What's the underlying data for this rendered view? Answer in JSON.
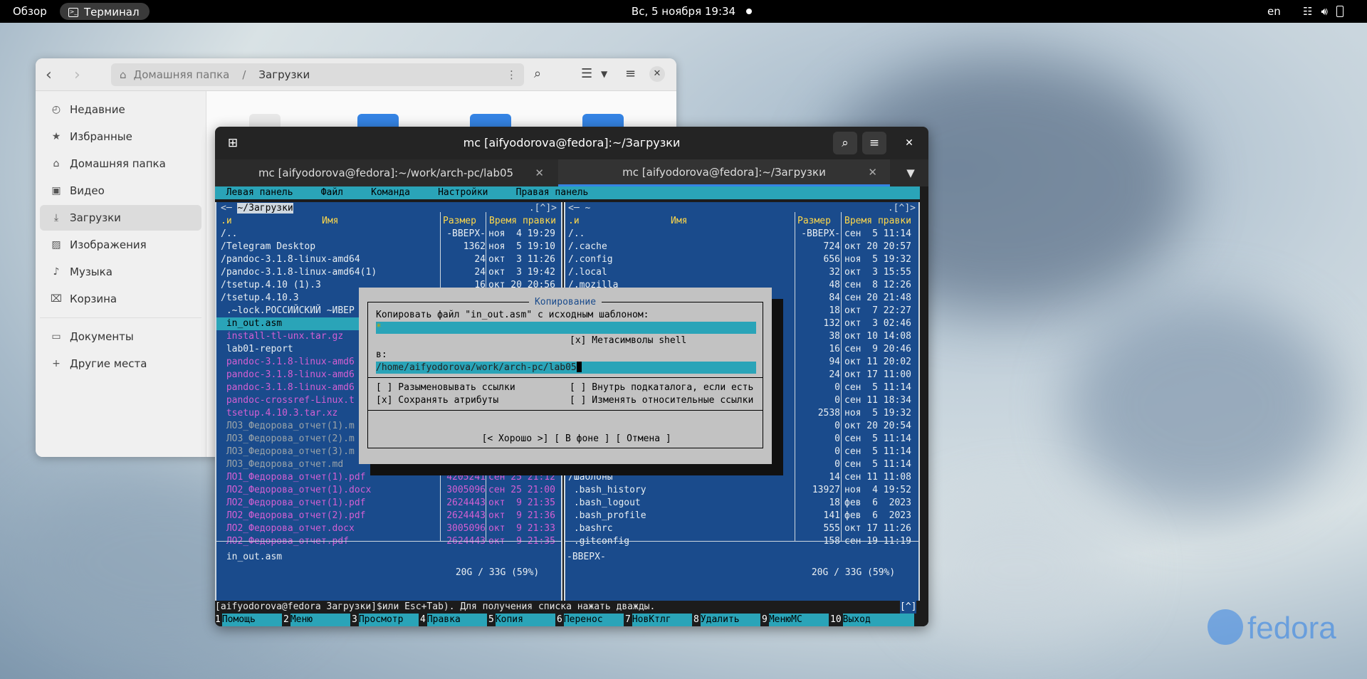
{
  "topbar": {
    "activities": "Обзор",
    "app": "Терминал",
    "clock": "Вс, 5 ноября  19:34",
    "lang": "en"
  },
  "files": {
    "path_home": "Домашняя папка",
    "path_sep": "/",
    "path_current": "Загрузки",
    "sidebar": [
      {
        "label": "Недавние",
        "icon": "clock-icon"
      },
      {
        "label": "Избранные",
        "icon": "star-icon"
      },
      {
        "label": "Домашняя папка",
        "icon": "home-icon"
      },
      {
        "label": "Видео",
        "icon": "video-icon"
      },
      {
        "label": "Загрузки",
        "icon": "download-icon",
        "selected": true
      },
      {
        "label": "Изображения",
        "icon": "image-icon"
      },
      {
        "label": "Музыка",
        "icon": "music-icon"
      },
      {
        "label": "Корзина",
        "icon": "trash-icon"
      }
    ],
    "sidebar2": [
      {
        "label": "Документы",
        "icon": "folder-icon"
      },
      {
        "label": "Другие места",
        "icon": "plus-icon"
      }
    ]
  },
  "terminal": {
    "title": "mc [aifyodorova@fedora]:~/Загрузки",
    "tabs": [
      {
        "label": "mc [aifyodorova@fedora]:~/work/arch-pc/lab05"
      },
      {
        "label": "mc [aifyodorova@fedora]:~/Загрузки",
        "active": true
      }
    ],
    "menubar": "  Левая панель     Файл     Команда     Настройки     Правая панель",
    "left": {
      "path": "~/Загрузки",
      "corner": ".[^]>",
      "col_n": ".и",
      "col_name": "Имя",
      "col_size": "Размер",
      "col_time": "Время правки",
      "rows": [
        {
          "name": "/..",
          "size": "-ВВЕРХ-",
          "time": "ноя  4 19:29",
          "cls": "white"
        },
        {
          "name": "/Telegram Desktop",
          "size": "1362",
          "time": "ноя  5 19:10",
          "cls": "white"
        },
        {
          "name": "/pandoc-3.1.8-linux-amd64",
          "size": "24",
          "time": "окт  3 11:26",
          "cls": "white"
        },
        {
          "name": "/pandoc-3.1.8-linux-amd64(1)",
          "size": "24",
          "time": "окт  3 19:42",
          "cls": "white"
        },
        {
          "name": "/tsetup.4.10 (1).3",
          "size": "16",
          "time": "окт 20 20:56",
          "cls": "white"
        },
        {
          "name": "/tsetup.4.10.3",
          "size": "",
          "time": "",
          "cls": "white"
        },
        {
          "name": " .~lock.РОССИЙСКИЙ ~ИВЕР",
          "size": "",
          "time": "",
          "cls": "white"
        },
        {
          "name": " in_out.asm",
          "size": "",
          "time": "",
          "cls": "sel"
        },
        {
          "name": " install-tl-unx.tar.gz",
          "size": "",
          "time": "",
          "cls": "mag"
        },
        {
          "name": " lab01-report",
          "size": "",
          "time": "",
          "cls": "white"
        },
        {
          "name": " pandoc-3.1.8-linux-amd6",
          "size": "",
          "time": "",
          "cls": "mag"
        },
        {
          "name": " pandoc-3.1.8-linux-amd6",
          "size": "",
          "time": "",
          "cls": "mag"
        },
        {
          "name": " pandoc-3.1.8-linux-amd6",
          "size": "",
          "time": "",
          "cls": "mag"
        },
        {
          "name": " pandoc-crossref-Linux.t",
          "size": "",
          "time": "",
          "cls": "mag"
        },
        {
          "name": " tsetup.4.10.3.tar.xz",
          "size": "",
          "time": "",
          "cls": "mag"
        },
        {
          "name": " ЛО3_Федорова_отчет(1).m",
          "size": "",
          "time": "",
          "cls": "gray"
        },
        {
          "name": " ЛО3_Федорова_отчет(2).m",
          "size": "",
          "time": "",
          "cls": "gray"
        },
        {
          "name": " ЛО3_Федорова_отчет(3).m",
          "size": "",
          "time": "",
          "cls": "gray"
        },
        {
          "name": " ЛО3_Федорова_отчет.md",
          "size": "",
          "time": "",
          "cls": "gray"
        },
        {
          "name": " ЛО1_Федорова_отчет(1).pdf",
          "size": "4205241",
          "time": "сен 25 21:12",
          "cls": "mag"
        },
        {
          "name": " ЛО2_Федорова_отчет(1).docx",
          "size": "3005096",
          "time": "сен 25 21:00",
          "cls": "mag"
        },
        {
          "name": " ЛО2_Федорова_отчет(1).pdf",
          "size": "2624443",
          "time": "окт  9 21:35",
          "cls": "mag"
        },
        {
          "name": " ЛО2_Федорова_отчет(2).pdf",
          "size": "2624443",
          "time": "окт  9 21:36",
          "cls": "mag"
        },
        {
          "name": " ЛО2_Федорова_отчет.docx",
          "size": "3005096",
          "time": "окт  9 21:33",
          "cls": "mag"
        },
        {
          "name": " ЛО2_Федорова_отчет.pdf",
          "size": "2624443",
          "time": "окт  9 21:35",
          "cls": "mag"
        }
      ],
      "status": " in_out.asm",
      "free": " 20G / 33G (59%) "
    },
    "right": {
      "path": "~",
      "corner": ".[^]>",
      "col_n": ".и",
      "col_name": "Имя",
      "col_size": "Размер",
      "col_time": "Время правки",
      "rows": [
        {
          "name": "/..",
          "size": "-ВВЕРХ-",
          "time": "сен  5 11:14"
        },
        {
          "name": "/.cache",
          "size": "724",
          "time": "окт 20 20:57"
        },
        {
          "name": "/.config",
          "size": "656",
          "time": "ноя  5 19:32"
        },
        {
          "name": "/.local",
          "size": "32",
          "time": "окт  3 15:55"
        },
        {
          "name": "/.mozilla",
          "size": "48",
          "time": "сен  8 12:26"
        },
        {
          "name": "",
          "size": "84",
          "time": "сен 20 21:48"
        },
        {
          "name": "",
          "size": "18",
          "time": "окт  7 22:27"
        },
        {
          "name": "",
          "size": "132",
          "time": "окт  3 02:46"
        },
        {
          "name": "",
          "size": "38",
          "time": "окт 10 14:08"
        },
        {
          "name": "",
          "size": "16",
          "time": "сен  9 20:46"
        },
        {
          "name": "",
          "size": "94",
          "time": "окт 11 20:02"
        },
        {
          "name": "",
          "size": "24",
          "time": "окт 17 11:00"
        },
        {
          "name": "",
          "size": "0",
          "time": "сен  5 11:14"
        },
        {
          "name": "",
          "size": "0",
          "time": "сен 11 18:34"
        },
        {
          "name": "",
          "size": "2538",
          "time": "ноя  5 19:32"
        },
        {
          "name": "",
          "size": "0",
          "time": "окт 20 20:54"
        },
        {
          "name": "",
          "size": "0",
          "time": "сен  5 11:14"
        },
        {
          "name": "",
          "size": "0",
          "time": "сен  5 11:14"
        },
        {
          "name": "",
          "size": "0",
          "time": "сен  5 11:14"
        },
        {
          "name": "/Шаблоны",
          "size": "14",
          "time": "сен 11 11:08"
        },
        {
          "name": " .bash_history",
          "size": "13927",
          "time": "ноя  4 19:52"
        },
        {
          "name": " .bash_logout",
          "size": "18",
          "time": "фев  6  2023"
        },
        {
          "name": " .bash_profile",
          "size": "141",
          "time": "фев  6  2023"
        },
        {
          "name": " .bashrc",
          "size": "555",
          "time": "окт 17 11:26"
        },
        {
          "name": " .gitconfig",
          "size": "158",
          "time": "сен 19 11:19"
        }
      ],
      "status": "-ВВЕРХ-",
      "free": " 20G / 33G (59%) "
    },
    "dialog": {
      "title": " Копирование ",
      "line1": "Копировать файл \"in_out.asm\" с исходным шаблоном:",
      "pattern": "*",
      "meta_check": "[x] Метасимволы shell",
      "to_label": "в:",
      "target": "/home/aifyodorova/work/arch-pc/lab05",
      "opt1": "[ ] Разыменовывать ссылки",
      "opt2": "[x] Сохранять атрибуты",
      "opt3": "[ ] Внутрь подкаталога, если есть",
      "opt4": "[ ] Изменять относительные ссылки",
      "btn_ok": "[< Хорошо >]",
      "btn_bg": "[ В фоне ]",
      "btn_cancel": "[ Отмена ]"
    },
    "hint": "Совет: Автодополнение: M-Tab (или Esc+Tab). Для получения списка нажать дважды.",
    "prompt": "[aifyodorova@fedora Загрузки]$",
    "caret": "[^]",
    "fkeys": [
      {
        "n": "1",
        "l": "Помощь"
      },
      {
        "n": "2",
        "l": "Меню"
      },
      {
        "n": "3",
        "l": "Просмотр"
      },
      {
        "n": "4",
        "l": "Правка"
      },
      {
        "n": "5",
        "l": "Копия"
      },
      {
        "n": "6",
        "l": "Перенос"
      },
      {
        "n": "7",
        "l": "НовКтлг"
      },
      {
        "n": "8",
        "l": "Удалить"
      },
      {
        "n": "9",
        "l": "МенюMC"
      },
      {
        "n": "10",
        "l": "Выход"
      }
    ]
  },
  "brand": "fedora"
}
